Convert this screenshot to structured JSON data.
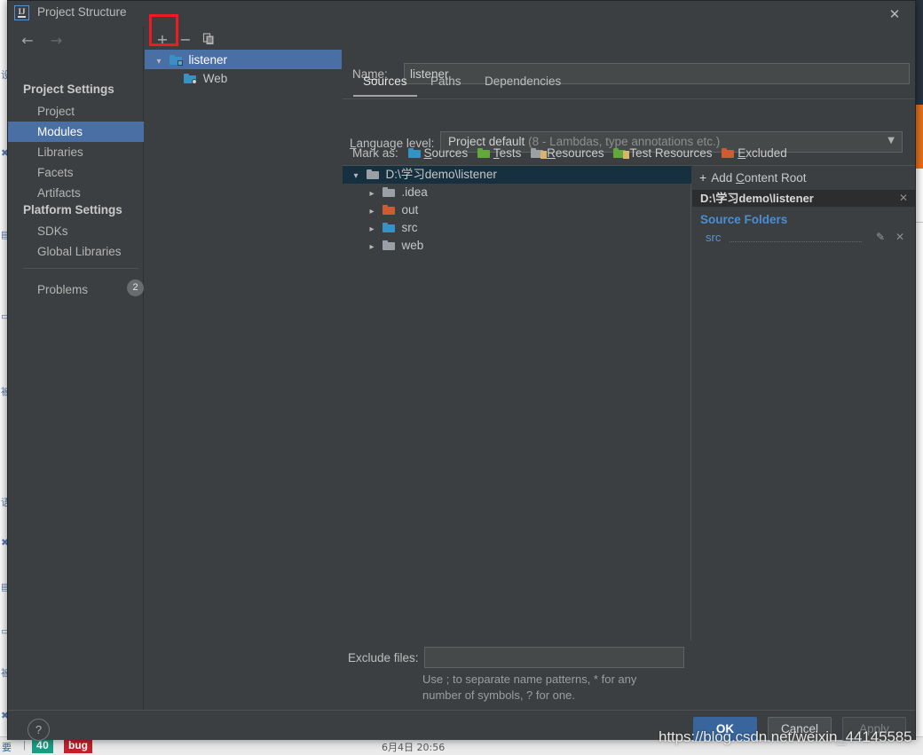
{
  "window": {
    "title": "Project Structure",
    "icon": "intellij-idea-icon",
    "close_label": "✕"
  },
  "nav": {
    "back_icon": "arrow-left-icon",
    "forward_icon": "arrow-right-icon"
  },
  "sidebar": {
    "sections": [
      {
        "heading": "Project Settings",
        "items": [
          {
            "label": "Project",
            "selected": false
          },
          {
            "label": "Modules",
            "selected": true
          },
          {
            "label": "Libraries",
            "selected": false
          },
          {
            "label": "Facets",
            "selected": false
          },
          {
            "label": "Artifacts",
            "selected": false
          }
        ]
      },
      {
        "heading": "Platform Settings",
        "items": [
          {
            "label": "SDKs",
            "selected": false
          },
          {
            "label": "Global Libraries",
            "selected": false
          }
        ]
      }
    ],
    "problems": {
      "label": "Problems",
      "count": "2"
    }
  },
  "modules_panel": {
    "toolbar": {
      "add_label": "+",
      "remove_label": "−",
      "copy_label": "copy-icon",
      "highlight_color": "#ee1c22"
    },
    "tree": [
      {
        "label": "listener",
        "icon": "module-folder-icon",
        "selected": true,
        "expanded": true,
        "depth": 0
      },
      {
        "label": "Web",
        "icon": "web-facet-icon",
        "selected": false,
        "depth": 1
      }
    ]
  },
  "main": {
    "name_label": "Name:",
    "name_value": "listener",
    "tabs": [
      {
        "label": "Sources",
        "active": true
      },
      {
        "label": "Paths",
        "active": false
      },
      {
        "label": "Dependencies",
        "active": false
      }
    ],
    "language_level": {
      "label": "Language level:",
      "value": "Project default",
      "hint": "(8 - Lambdas, type annotations etc.)",
      "arrow_icon": "chevron-down-icon"
    },
    "mark_as": {
      "label": "Mark as:",
      "options": [
        {
          "label": "Sources",
          "mnemonic": "S",
          "color": "#3592c4",
          "icon": "folder-sources-icon"
        },
        {
          "label": "Tests",
          "mnemonic": "T",
          "color": "#62a83b",
          "icon": "folder-tests-icon"
        },
        {
          "label": "Resources",
          "mnemonic": "R",
          "color": "#9aa0a6",
          "icon": "folder-resources-icon"
        },
        {
          "label": "Test Resources",
          "mnemonic": "",
          "color": "#9aa0a6",
          "icon": "folder-test-resources-icon"
        },
        {
          "label": "Excluded",
          "mnemonic": "E",
          "color": "#cf5b32",
          "icon": "folder-excluded-icon"
        }
      ]
    },
    "file_tree": [
      {
        "label": "D:\\学习demo\\listener",
        "icon": "folder-gray-icon",
        "depth": 0,
        "expanded": true,
        "selected": true
      },
      {
        "label": ".idea",
        "icon": "folder-gray-icon",
        "depth": 1,
        "expanded": false,
        "selected": false
      },
      {
        "label": "out",
        "icon": "folder-orange-icon",
        "depth": 1,
        "expanded": false,
        "selected": false
      },
      {
        "label": "src",
        "icon": "folder-blue-icon",
        "depth": 1,
        "expanded": false,
        "selected": false
      },
      {
        "label": "web",
        "icon": "folder-gray-icon",
        "depth": 1,
        "expanded": false,
        "selected": false
      }
    ],
    "content_roots": {
      "add_label": "Add Content Root",
      "add_mnemonic": "C",
      "root_path": "D:\\学习demo\\listener",
      "root_remove_icon": "close-icon",
      "source_folders_title": "Source Folders",
      "source_folders": [
        {
          "label": "src",
          "edit_icon": "pencil-icon",
          "remove_icon": "close-icon"
        }
      ]
    },
    "exclude": {
      "label": "Exclude files:",
      "value": "",
      "hint_line1": "Use ; to separate name patterns, * for any",
      "hint_line2": "number of symbols, ? for one."
    }
  },
  "footer": {
    "help_label": "?",
    "buttons": [
      {
        "label": "OK",
        "style": "primary",
        "enabled": true
      },
      {
        "label": "Cancel",
        "style": "normal",
        "enabled": true
      },
      {
        "label": "Apply",
        "style": "disabled",
        "enabled": false
      }
    ]
  },
  "watermark": {
    "text": "https://blog.csdn.net/weixin_44145585"
  },
  "taskbar": {
    "left_glyph": "要",
    "separator": "|",
    "badge_count": "40",
    "badge_bug": "bug",
    "clock": "6月4日 20:56"
  }
}
